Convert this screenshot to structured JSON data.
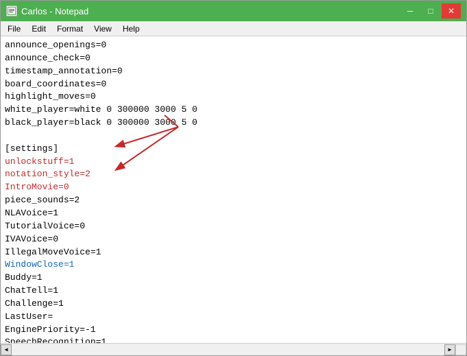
{
  "window": {
    "title": "Carlos - Notepad",
    "icon": "notepad-icon"
  },
  "titlebar": {
    "minimize_label": "─",
    "maximize_label": "□",
    "close_label": "✕"
  },
  "menu": {
    "items": [
      "File",
      "Edit",
      "Format",
      "View",
      "Help"
    ]
  },
  "content": {
    "lines": [
      {
        "text": "announce_openings=0",
        "style": "normal"
      },
      {
        "text": "announce_check=0",
        "style": "normal"
      },
      {
        "text": "timestamp_annotation=0",
        "style": "normal"
      },
      {
        "text": "board_coordinates=0",
        "style": "normal"
      },
      {
        "text": "highlight_moves=0",
        "style": "normal"
      },
      {
        "text": "white_player=white 0 300000 3000 5 0",
        "style": "normal"
      },
      {
        "text": "black_player=black 0 300000 3000 5 0",
        "style": "normal"
      },
      {
        "text": "",
        "style": "normal"
      },
      {
        "text": "[settings]",
        "style": "normal"
      },
      {
        "text": "unlockstuff=1",
        "style": "red"
      },
      {
        "text": "notation_style=2",
        "style": "red"
      },
      {
        "text": "IntroMovie=0",
        "style": "red"
      },
      {
        "text": "piece_sounds=2",
        "style": "normal"
      },
      {
        "text": "NLAVoice=1",
        "style": "normal"
      },
      {
        "text": "TutorialVoice=0",
        "style": "normal"
      },
      {
        "text": "IVAVoice=0",
        "style": "normal"
      },
      {
        "text": "IllegalMoveVoice=1",
        "style": "normal"
      },
      {
        "text": "WindowClose=1",
        "style": "blue"
      },
      {
        "text": "Buddy=1",
        "style": "normal"
      },
      {
        "text": "ChatTell=1",
        "style": "normal"
      },
      {
        "text": "Challenge=1",
        "style": "normal"
      },
      {
        "text": "LastUser=",
        "style": "normal"
      },
      {
        "text": "EnginePriority=-1",
        "style": "normal"
      },
      {
        "text": "SpeechRecognition=1",
        "style": "normal"
      }
    ]
  }
}
